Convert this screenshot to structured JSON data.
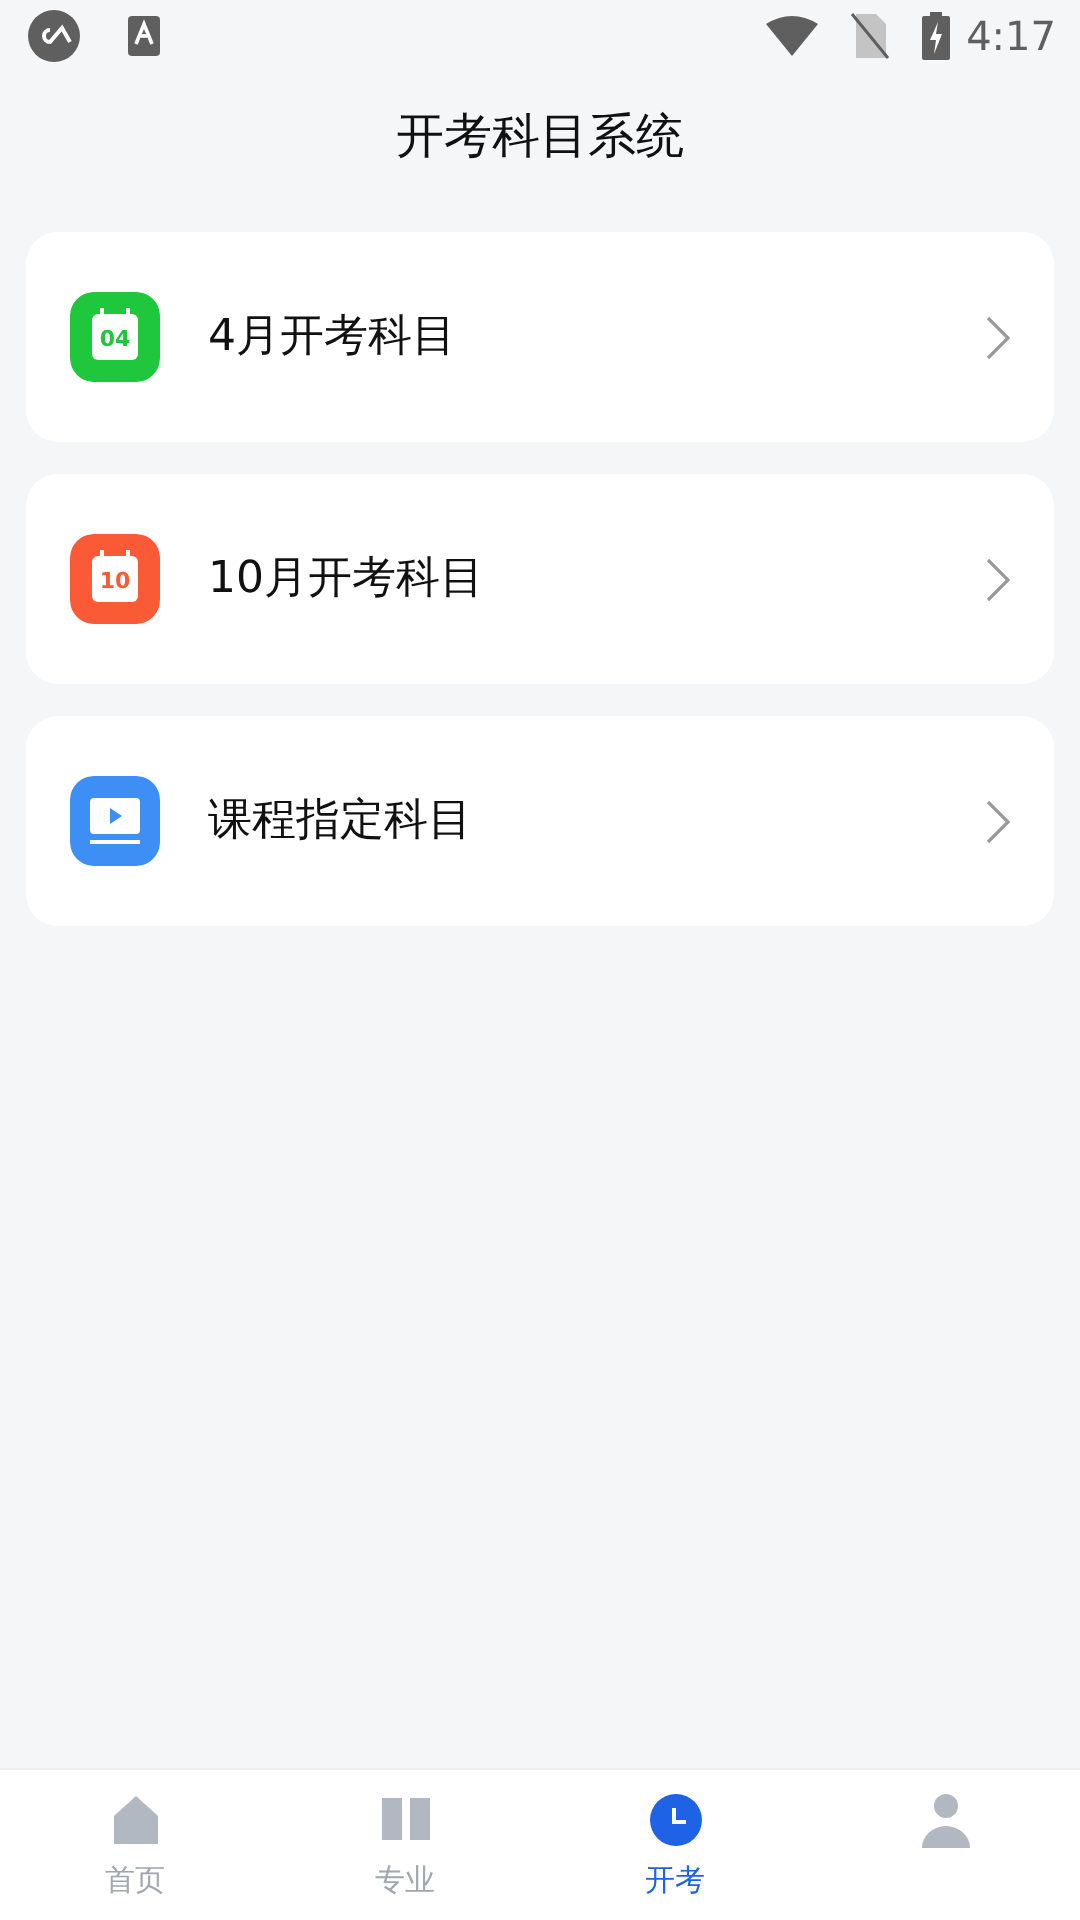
{
  "status_bar": {
    "time": "4:17"
  },
  "header": {
    "title": "开考科目系统"
  },
  "menu_items": [
    {
      "kind": "calendar",
      "icon_text": "04",
      "color": "#1ec73c",
      "label": "4月开考科目"
    },
    {
      "kind": "calendar",
      "icon_text": "10",
      "color": "#fa5a35",
      "label": "10月开考科目"
    },
    {
      "kind": "video",
      "color": "#3d8ff5",
      "label": "课程指定科目"
    }
  ],
  "tab_bar": [
    {
      "kind": "home",
      "label": "首页",
      "selected": false
    },
    {
      "kind": "book",
      "label": "专业",
      "selected": false
    },
    {
      "kind": "clock",
      "label": "开考",
      "selected": true
    },
    {
      "kind": "person",
      "selected": false
    }
  ]
}
